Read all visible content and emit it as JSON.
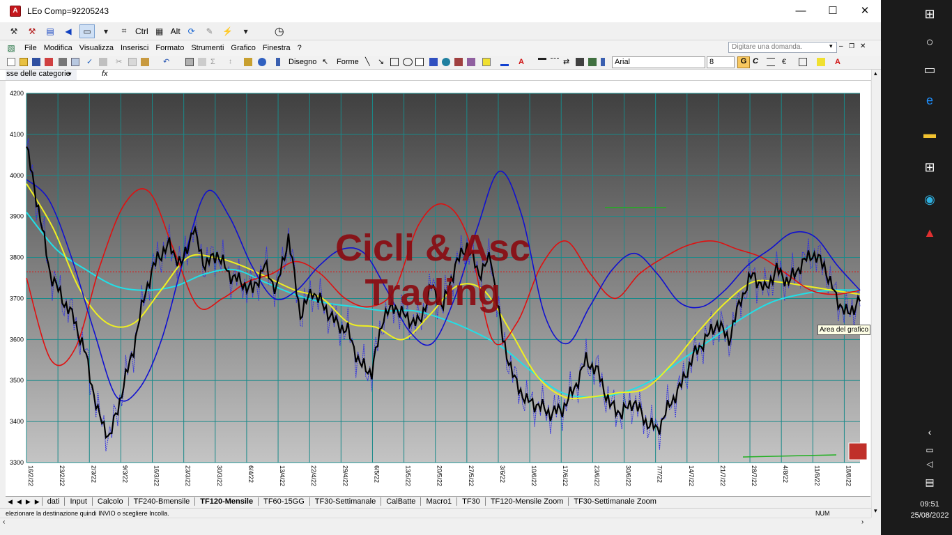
{
  "window": {
    "title": "LEo Comp=92205243",
    "minimize": "—",
    "maximize": "☐",
    "close": "✕"
  },
  "leo_toolbar": {
    "ctrl_label": "Ctrl",
    "alt_label": "Alt"
  },
  "menu": {
    "items": [
      "File",
      "Modifica",
      "Visualizza",
      "Inserisci",
      "Formato",
      "Strumenti",
      "Grafico",
      "Finestra",
      "?"
    ],
    "help_placeholder": "Digitare una domanda."
  },
  "drawing_toolbar": {
    "disegno": "Disegno",
    "forme": "Forme",
    "font_name": "Arial",
    "font_size": "8",
    "bold": "G",
    "italic": "C"
  },
  "formula_bar": {
    "name_box": "sse delle categorie",
    "fx": "fx"
  },
  "chart_data": {
    "type": "line",
    "watermark": [
      "Cicli & Asc",
      "Trading"
    ],
    "ylim": [
      3300,
      4200
    ],
    "yticks": [
      "3300",
      "3400",
      "3500",
      "3600",
      "3700",
      "3800",
      "3900",
      "4000",
      "4100",
      "4200"
    ],
    "xticks": [
      "16/2/22",
      "23/2/22",
      "2/3/22",
      "9/3/22",
      "16/3/22",
      "23/3/22",
      "30/3/22",
      "6/4/22",
      "13/4/22",
      "22/4/22",
      "29/4/22",
      "6/5/22",
      "13/5/22",
      "20/5/22",
      "27/5/22",
      "3/6/22",
      "10/6/22",
      "17/6/22",
      "23/6/22",
      "30/6/22",
      "7/7/22",
      "14/7/22",
      "21/7/22",
      "28/7/22",
      "4/8/22",
      "11/8/22",
      "18/8/22"
    ],
    "grid": true,
    "reference_level": 3765,
    "colors": {
      "price": "#000000",
      "blue": "#1010d0",
      "red": "#e01010",
      "yellow": "#f0f020",
      "cyan": "#20e0e8",
      "dotted": "#3030e0",
      "reference": "#e01010",
      "green": "#20b020"
    },
    "series": [
      {
        "values": [
          4070,
          3920,
          3760,
          3700,
          3650,
          3560,
          3420,
          3360,
          3470,
          3580,
          3720,
          3800,
          3830,
          3780,
          3870,
          3780,
          3810,
          3760,
          3740,
          3720,
          3780,
          3720,
          3850,
          3660,
          3720,
          3680,
          3640,
          3620,
          3540,
          3520,
          3660,
          3680,
          3650,
          3640,
          3730,
          3680,
          3780,
          3830,
          3760,
          3800,
          3600,
          3500,
          3450,
          3440,
          3420,
          3430,
          3480,
          3550,
          3520,
          3440,
          3420,
          3450,
          3400,
          3380,
          3440,
          3490,
          3560,
          3600,
          3640,
          3600,
          3700,
          3760,
          3720,
          3770,
          3740,
          3780,
          3810,
          3780,
          3700,
          3660,
          3700
        ]
      },
      {
        "values": [
          3990,
          3940,
          3800,
          3620,
          3460,
          3480,
          3600,
          3800,
          3960,
          3900,
          3780,
          3700,
          3720,
          3780,
          3820,
          3810,
          3720,
          3620,
          3590,
          3700,
          3870,
          4010,
          3900,
          3660,
          3590,
          3680,
          3770,
          3810,
          3760,
          3690,
          3680,
          3720,
          3780,
          3820,
          3860,
          3850,
          3780,
          3720
        ]
      },
      {
        "values": [
          3750,
          3550,
          3580,
          3780,
          3930,
          3960,
          3820,
          3680,
          3700,
          3740,
          3760,
          3790,
          3760,
          3700,
          3680,
          3720,
          3880,
          3930,
          3850,
          3600,
          3640,
          3780,
          3840,
          3760,
          3700,
          3760,
          3800,
          3830,
          3840,
          3820,
          3800,
          3760,
          3720,
          3710,
          3720
        ]
      },
      {
        "values": [
          3980,
          3870,
          3720,
          3640,
          3640,
          3720,
          3800,
          3800,
          3780,
          3750,
          3720,
          3700,
          3640,
          3630,
          3600,
          3660,
          3730,
          3720,
          3620,
          3510,
          3460,
          3460,
          3470,
          3480,
          3540,
          3620,
          3690,
          3740,
          3740,
          3730,
          3720,
          3710
        ]
      },
      {
        "values": [
          3910,
          3820,
          3770,
          3730,
          3720,
          3730,
          3760,
          3770,
          3740,
          3710,
          3690,
          3680,
          3670,
          3670,
          3650,
          3620,
          3580,
          3520,
          3470,
          3460,
          3470,
          3500,
          3550,
          3600,
          3650,
          3690,
          3710,
          3720,
          3720
        ]
      }
    ]
  },
  "sheet_tabs": [
    "dati",
    "Input",
    "Calcolo",
    "TF240-Bmensile",
    "TF120-Mensile",
    "TF60-15GG",
    "TF30-Settimanale",
    "CalBatte",
    "Macro1",
    "TF30",
    "TF120-Mensile Zoom",
    "TF30-Settimanale Zoom"
  ],
  "active_tab": "TF120-Mensile",
  "status": {
    "message": "elezionare la destinazione quindi INVIO o scegliere Incolla.",
    "num": "NUM"
  },
  "tooltip": "Area del grafico",
  "taskbar": {
    "time": "09:51",
    "date": "25/08/2022"
  }
}
